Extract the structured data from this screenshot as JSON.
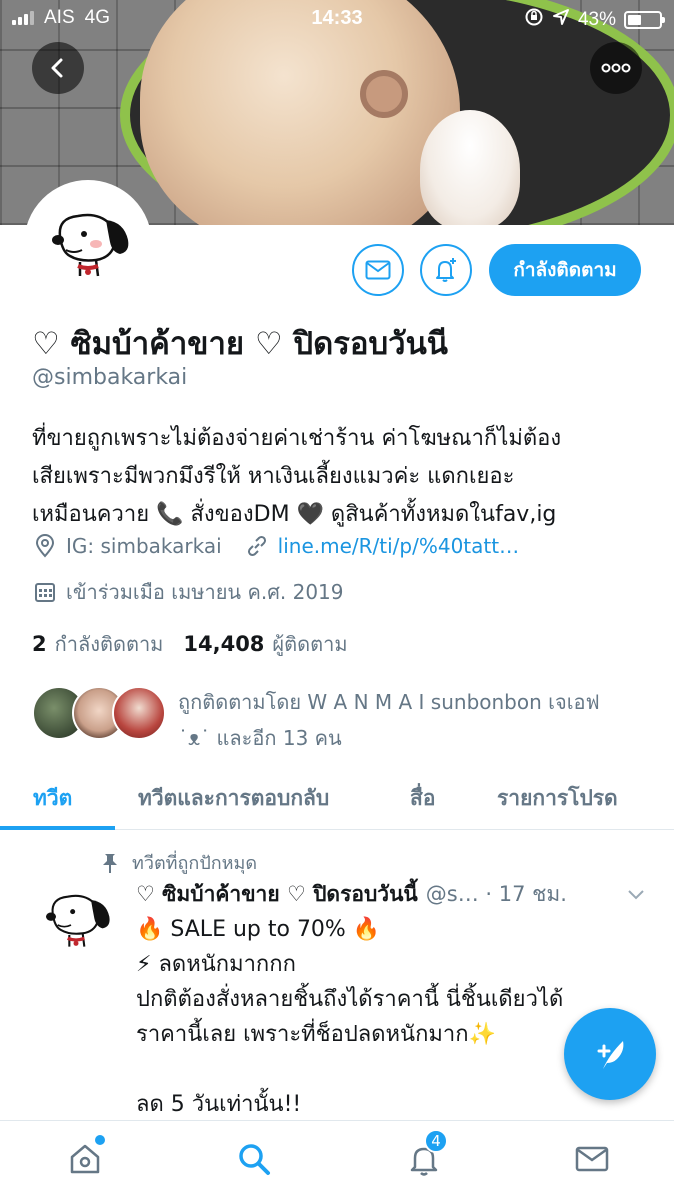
{
  "status_bar": {
    "carrier": "AIS",
    "network": "4G",
    "time": "14:33",
    "battery": "43%",
    "battery_level": 0.43
  },
  "profile": {
    "display_name": "♡ ซิมบ้าค้าขาย ♡ ปิดรอบวันนี",
    "handle": "@simbakarkai",
    "bio_lines": [
      "ที่ขายถูกเพราะไม่ต้องจ่ายค่าเช่าร้าน ค่าโฆษณาก็ไม่ต้อง",
      "เสียเพราะมีพวกมึงรีให้ หาเงินเลี้ยงแมวค่ะ แดกเยอะ",
      "เหมือนควาย 📞 สั่งของDM 🖤 ดูสินค้าทั้งหมดในfav,ig"
    ],
    "location": "IG: simbakarkai",
    "link": "line.me/R/ti/p/%40tatt…",
    "joined": "เข้าร่วมเมือ เมษายน ค.ศ. 2019",
    "following_count": "2",
    "following_label": "กำลังติดตาม",
    "followers_count": "14,408",
    "followers_label": "ผู้ติดตาม",
    "followed_by_line1": "ถูกติดตามโดย W A N M A I sunbonbon เจเอฟ",
    "followed_by_line2": "˙ᴥ˙ และอีก 13 คน"
  },
  "actions": {
    "follow_label": "กำลังติดตาม"
  },
  "tabs": [
    {
      "label": "ทวีต",
      "active": true
    },
    {
      "label": "ทวีตและการตอบกลับ",
      "active": false
    },
    {
      "label": "สื่อ",
      "active": false
    },
    {
      "label": "รายการโปรด",
      "active": false
    }
  ],
  "pinned_tweet": {
    "pinned_label": "ทวีตที่ถูกปักหมุด",
    "author": "♡ ซิมบ้าค้าขาย ♡ ปิดรอบวันนี้",
    "handle_time": "@s… · 17 ชม.",
    "lines": [
      "🔥 SALE up to 70% 🔥",
      "⚡ ลดหนักมากกก",
      "ปกติต้องสั่งหลายชิ้นถึงได้ราคานี้ นี่ชิ้นเดียวได้",
      "ราคานี้เลย เพราะที่ช็อปลดหนักมาก✨",
      "",
      "ลด 5 วันเท่านั้น!!"
    ]
  },
  "bottom_nav": {
    "notifications_badge": "4"
  },
  "icons": {
    "back": "chevron-left-icon",
    "more": "more-dots-icon",
    "message": "envelope-icon",
    "notify": "bell-plus-icon",
    "location": "location-pin-icon",
    "link": "link-icon",
    "calendar": "calendar-icon",
    "pin": "pin-icon",
    "caret": "chevron-down-icon",
    "compose": "compose-feather-icon",
    "home": "home-icon",
    "search": "search-icon",
    "notifications": "bell-icon",
    "messages": "envelope-icon"
  },
  "colors": {
    "accent": "#1da1f2",
    "text": "#14171a",
    "secondary_text": "#657786"
  }
}
